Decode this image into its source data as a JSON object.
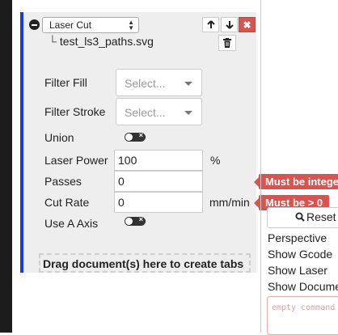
{
  "operation": {
    "type_label": "Laser Cut",
    "file_name": "test_ls3_paths.svg",
    "tree_glyph": "└",
    "move_up_symbol": "🡑",
    "move_down_symbol": "🡓",
    "close_symbol": "✖"
  },
  "fields": {
    "filter_fill": {
      "label": "Filter Fill",
      "placeholder": "Select..."
    },
    "filter_stroke": {
      "label": "Filter Stroke",
      "placeholder": "Select..."
    },
    "union": {
      "label": "Union",
      "checked": false
    },
    "laser_power": {
      "label": "Laser Power",
      "value": "100",
      "unit": "%"
    },
    "passes": {
      "label": "Passes",
      "value": "0",
      "error": "Must be intege"
    },
    "cut_rate": {
      "label": "Cut Rate",
      "value": "0",
      "unit": "mm/min",
      "error": "Must be > 0"
    },
    "use_a_axis": {
      "label": "Use A Axis",
      "checked": false
    }
  },
  "drag_hint": "Drag document(s) here to create tabs",
  "right_panel": {
    "reset_label": "Reset",
    "menu": [
      "Perspective",
      "Show Gcode",
      "Show Laser",
      "Show Docume"
    ],
    "command_placeholder": "empty command"
  },
  "colors": {
    "accent_border": "#1f3bd6",
    "error": "#d9534f",
    "sidebar_dark": "#1c1c1c"
  },
  "icons": {
    "remove": "minus-circle-icon",
    "trash": "trash-icon",
    "search": "search-icon",
    "toggle": "toggle-icon"
  }
}
